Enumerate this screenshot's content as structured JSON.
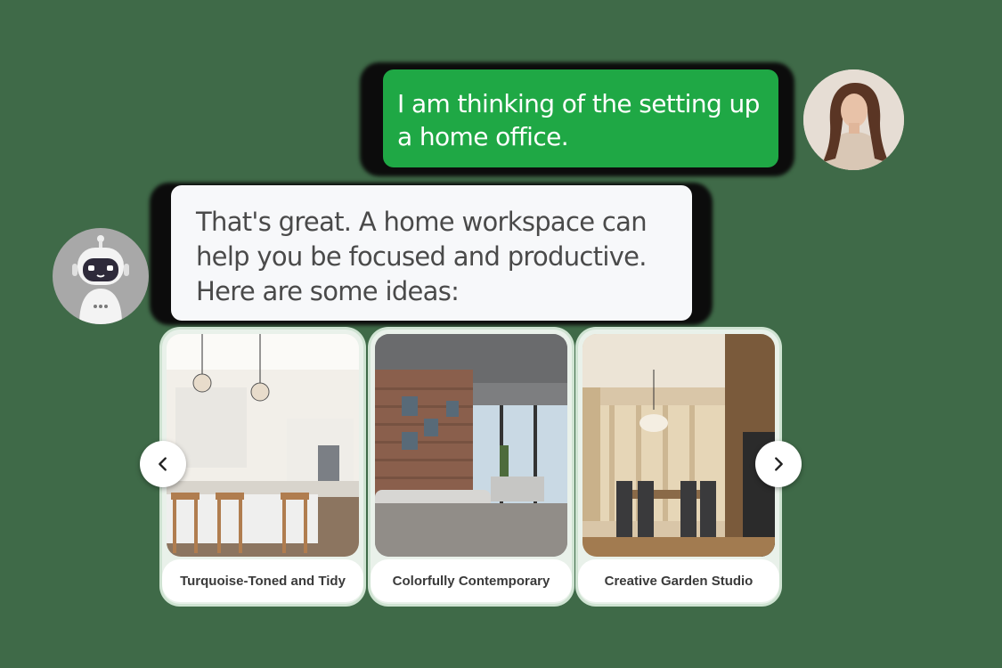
{
  "chat": {
    "user_message": "I am thinking of the setting up a home office.",
    "bot_message": "That's great. A home workspace can help you be focused and productive. Here are some ideas:"
  },
  "carousel": {
    "cards": [
      {
        "label": "Turquoise-Toned and Tidy"
      },
      {
        "label": "Colorfully Contemporary"
      },
      {
        "label": "Creative Garden Studio"
      }
    ],
    "prev_icon": "chevron-left-icon",
    "next_icon": "chevron-right-icon"
  },
  "colors": {
    "user_bubble": "#1fa845",
    "bot_bubble": "#f7f8fa",
    "background": "#3f6a48"
  }
}
